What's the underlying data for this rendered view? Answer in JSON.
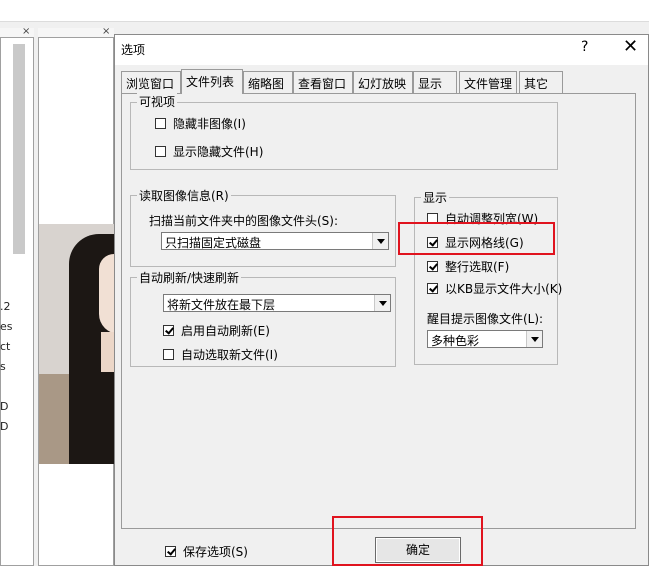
{
  "dialog": {
    "title": "选项",
    "help": "?",
    "close": "✕"
  },
  "tabs": [
    "浏览窗口",
    "文件列表",
    "缩略图",
    "查看窗口",
    "幻灯放映",
    "显示",
    "文件管理",
    "其它"
  ],
  "active_tab": "文件列表",
  "visible_group": {
    "label": "可视项",
    "hide_non_images": "隐藏非图像(I)",
    "show_hidden_files": "显示隐藏文件(H)"
  },
  "read_info": {
    "label": "读取图像信息(R)",
    "scan_label": "扫描当前文件夹中的图像文件头(S):",
    "scan_value": "只扫描固定式磁盘"
  },
  "refresh": {
    "label": "自动刷新/快速刷新",
    "position_value": "将新文件放在最下层",
    "enable_auto_refresh": "启用自动刷新(E)",
    "auto_select_new": "自动选取新文件(I)"
  },
  "display": {
    "label": "显示",
    "auto_col_width": "自动调整列宽(W)",
    "show_grid": "显示网格线(G)",
    "row_select": "整行选取(F)",
    "kb_size": "以KB显示文件大小(K)",
    "remind_label": "醒目提示图像文件(L):",
    "remind_value": "多种色彩"
  },
  "footer": {
    "save_options": "保存选项(S)",
    "ok": "确定"
  },
  "background": {
    "side_texts": [
      ".2",
      "es",
      "ct",
      "s",
      "D",
      "D"
    ],
    "pane_close_1": "×",
    "pane_close_2": "×"
  },
  "colors": {
    "highlight": "#e0131e"
  }
}
